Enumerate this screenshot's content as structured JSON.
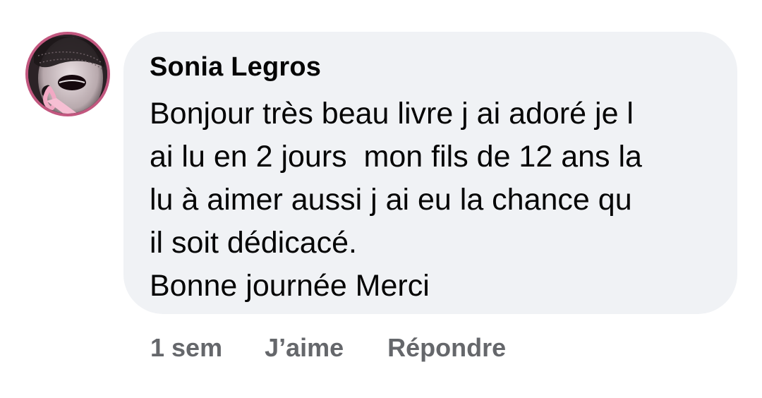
{
  "comment": {
    "author": "Sonia Legros",
    "avatar_icon": "profile-avatar-pink-ribbon",
    "text_lines": [
      "Bonjour très beau livre j ai adoré je l",
      "ai lu en 2 jours  mon fils de 12 ans la",
      "lu à aimer aussi j ai eu la chance qu",
      "il soit dédicacé.",
      "Bonne journée Merci"
    ],
    "bubble_color": "#f0f2f5",
    "avatar_border_color": "#c2577f"
  },
  "actions": {
    "timestamp": "1 sem",
    "like_label": "J’aime",
    "reply_label": "Répondre",
    "color": "#65676b"
  }
}
